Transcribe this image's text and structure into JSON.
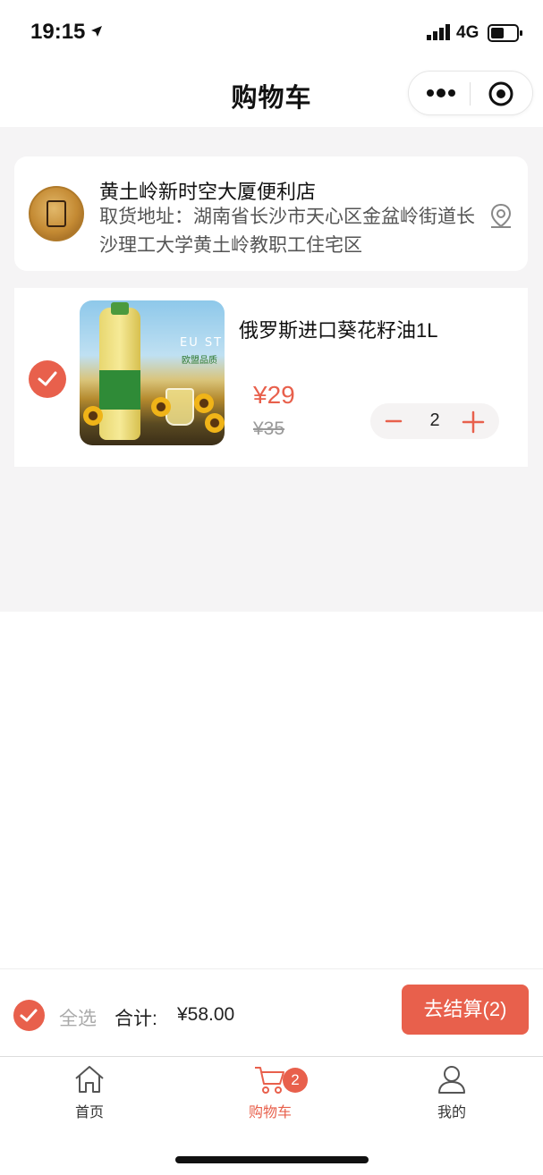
{
  "status_bar": {
    "time": "19:15",
    "network": "4G"
  },
  "nav": {
    "title": "购物车",
    "more_icon": "more-dots-icon",
    "close_icon": "target-close-icon"
  },
  "store": {
    "name": "黄土岭新时空大厦便利店",
    "address": "取货地址：湖南省长沙市天心区金盆岭街道长沙理工大学黄土岭教职工住宅区",
    "pin_icon": "location-pin-icon"
  },
  "cart_item": {
    "name": "俄罗斯进口葵花籽油1L",
    "price": "¥29",
    "original_price": "¥35",
    "quantity": "2",
    "image_text": "EU ST",
    "image_subtext": "欧盟品质",
    "checked": true
  },
  "checkout": {
    "select_all_label": "全选",
    "total_label": "合计:",
    "total_value": "¥58.00",
    "button_label": "去结算(2)"
  },
  "tabs": [
    {
      "label": "首页",
      "icon": "home-icon"
    },
    {
      "label": "购物车",
      "icon": "cart-icon",
      "badge": "2"
    },
    {
      "label": "我的",
      "icon": "user-icon"
    }
  ],
  "colors": {
    "accent": "#e8604c",
    "background": "#f5f4f5"
  }
}
